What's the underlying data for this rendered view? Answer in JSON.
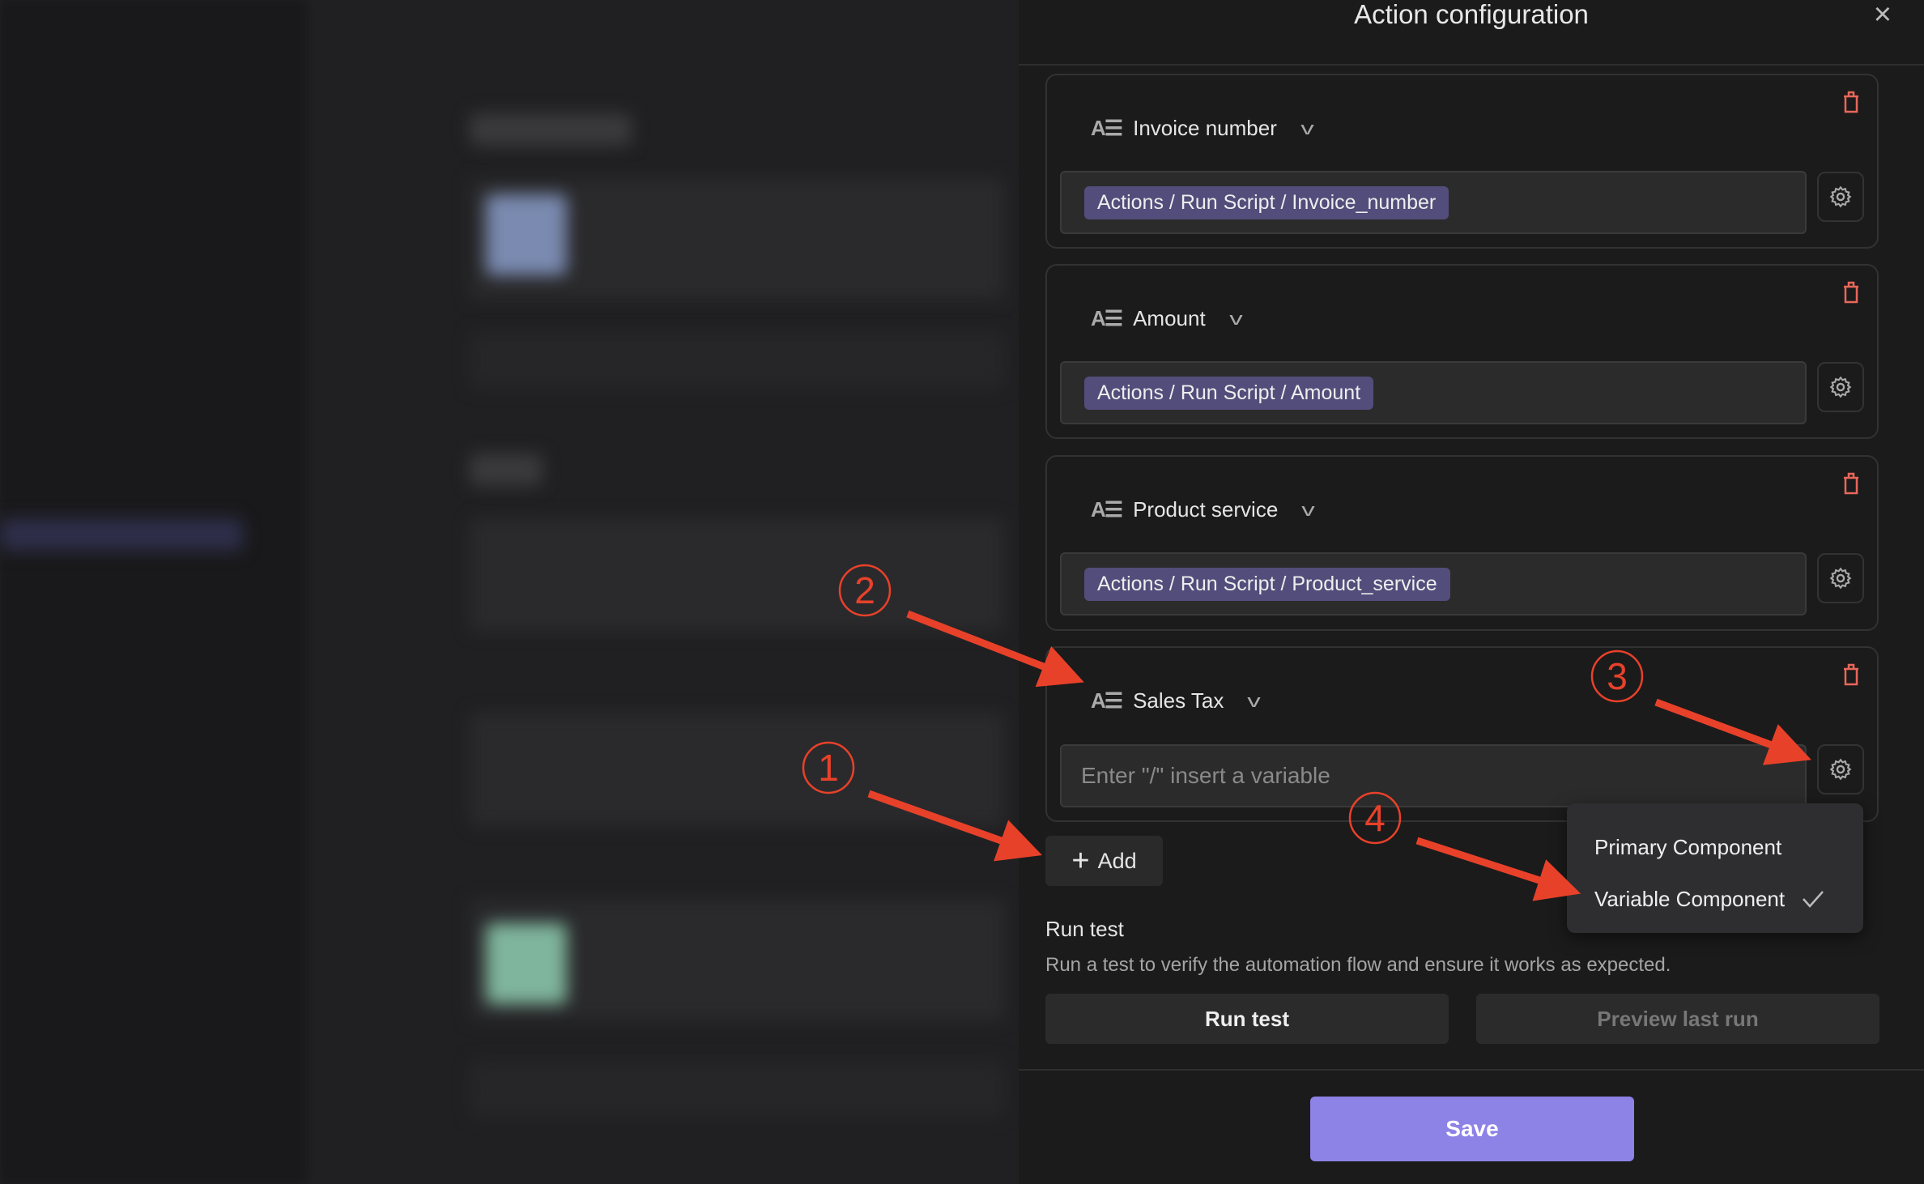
{
  "panel": {
    "title": "Action configuration",
    "close_icon": "close-icon"
  },
  "fields": [
    {
      "label": "Invoice number",
      "value_chip": "Actions / Run Script / Invoice_number"
    },
    {
      "label": "Amount",
      "value_chip": "Actions / Run Script / Amount"
    },
    {
      "label": "Product service",
      "value_chip": "Actions / Run Script / Product_service"
    },
    {
      "label": "Sales Tax",
      "placeholder": "Enter \"/\" insert a variable"
    }
  ],
  "add_label": "Add",
  "dropdown": {
    "options": [
      {
        "label": "Primary Component",
        "selected": false
      },
      {
        "label": "Variable Component",
        "selected": true
      }
    ]
  },
  "run_test": {
    "title": "Run test",
    "description": "Run a test to verify the automation flow and ensure it works as expected.",
    "run_label": "Run test",
    "preview_label": "Preview last run"
  },
  "save_label": "Save",
  "annotations": [
    "1",
    "2",
    "3",
    "4"
  ],
  "colors": {
    "accent": "#8d82e6",
    "chip": "#524d7a",
    "delete": "#e8675a",
    "annotation": "#e8412a"
  }
}
